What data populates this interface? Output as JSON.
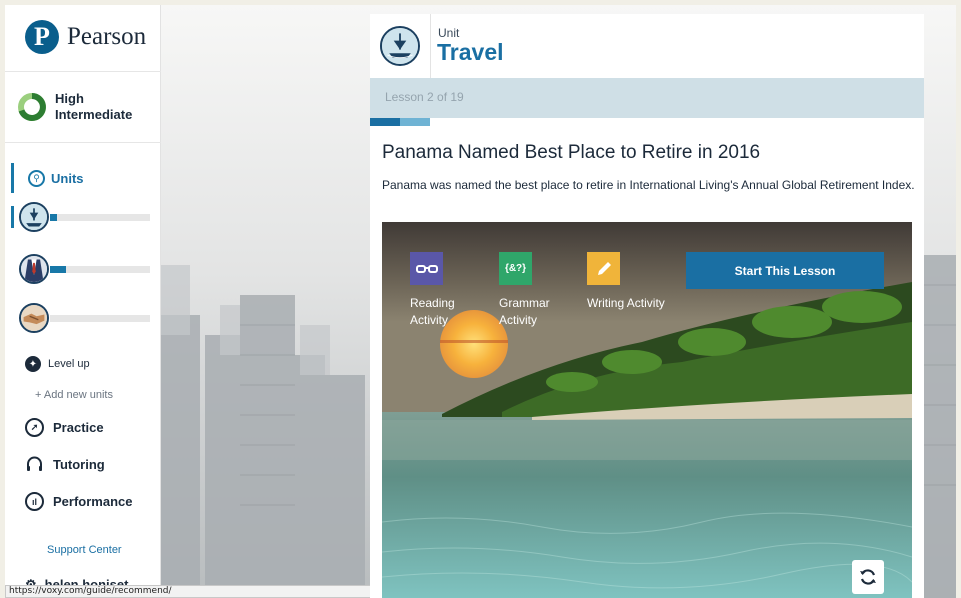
{
  "brand": {
    "logo_letter": "P",
    "name": "Pearson"
  },
  "level": {
    "line1": "High",
    "line2": "Intermediate"
  },
  "sidebar": {
    "units_label": "Units",
    "unit_progress": [
      0.07,
      0.16,
      0.0
    ],
    "level_up": "Level up",
    "add_units": "+ Add new units",
    "nav": [
      {
        "label": "Practice",
        "icon": "compass-icon"
      },
      {
        "label": "Tutoring",
        "icon": "headset-icon"
      },
      {
        "label": "Performance",
        "icon": "chart-icon"
      }
    ],
    "support": "Support Center",
    "user": "helen honiset"
  },
  "status_url": "https://voxy.com/guide/recommend/",
  "unit": {
    "kicker": "Unit",
    "title": "Travel",
    "lesson_count": "Lesson 2 of 19"
  },
  "lesson": {
    "title": "Panama Named Best Place to Retire in 2016",
    "description": "Panama was named the best place to retire in International Living's Annual Global Retirement Index.",
    "activities": [
      {
        "line1": "Reading",
        "line2": "Activity",
        "icon": "glasses-icon",
        "color": "#5a57a8"
      },
      {
        "line1": "Grammar",
        "line2": "Activity",
        "icon": "grammar-icon",
        "color": "#2fa66a"
      },
      {
        "line1": "Writing Activity",
        "line2": "",
        "icon": "pencil-icon",
        "color": "#f0b43a"
      }
    ],
    "start_label": "Start This Lesson"
  },
  "colors": {
    "accent": "#1a6fa3",
    "lesson_bar": "#cfdfe6"
  }
}
